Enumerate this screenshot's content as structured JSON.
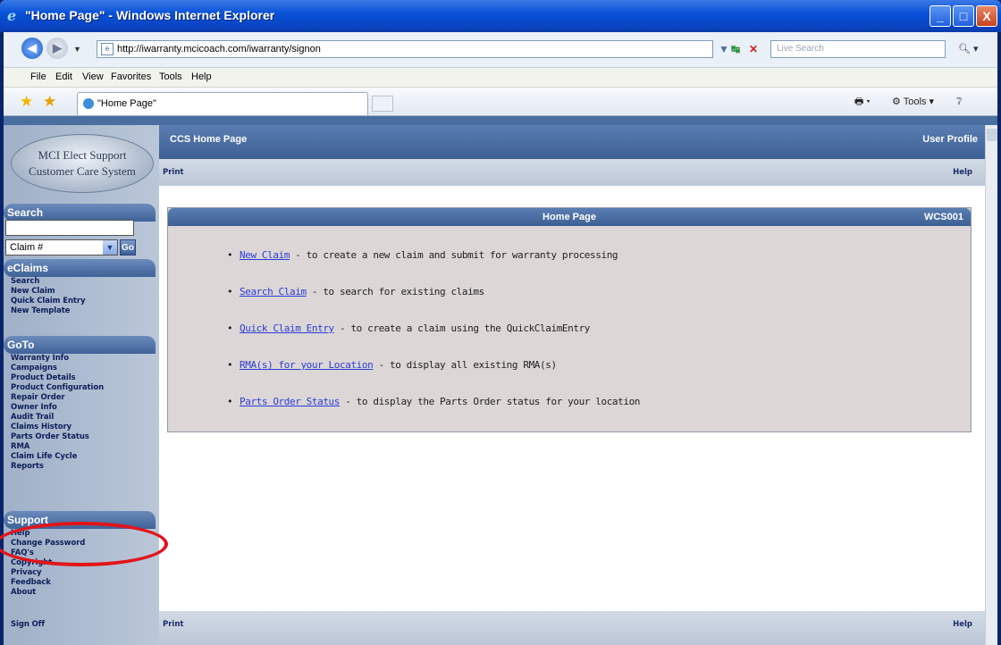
{
  "window": {
    "title": "\"Home Page\" - Windows Internet Explorer",
    "controls": [
      "_",
      "□",
      "X"
    ]
  },
  "address_bar": {
    "url": "http://iwarranty.mcicoach.com/iwarranty/signon",
    "search_placeholder": "Live Search"
  },
  "menu": [
    "File",
    "Edit",
    "View",
    "Favorites",
    "Tools",
    "Help"
  ],
  "tab": {
    "label": "\"Home Page\""
  },
  "command_bar": {
    "tools_label": "Tools"
  },
  "sidebar": {
    "logo_line1": "MCI Elect Support",
    "logo_line2": "Customer Care System",
    "search_title": "Search",
    "search_select_value": "Claim #",
    "go_label": "Go",
    "eclaims_title": "eClaims",
    "eclaims_links": [
      "Search",
      "New Claim",
      "Quick Claim Entry",
      "New Template"
    ],
    "goto_title": "GoTo",
    "goto_links": [
      "Warranty Info",
      "Campaigns",
      "Product Details",
      "Product Configuration",
      "Repair Order",
      "Owner Info",
      "Audit Trail",
      "Claims History",
      "Parts Order Status",
      "RMA",
      "Claim Life Cycle",
      "Reports"
    ],
    "support_title": "Support",
    "support_links": [
      "Help",
      "Change Password",
      "FAQ's",
      "Copyright",
      "Privacy",
      "Feedback",
      "About"
    ],
    "sign_off": "Sign Off"
  },
  "header": {
    "title": "CCS Home Page",
    "user_profile": "User Profile",
    "print": "Print",
    "help": "Help"
  },
  "panel": {
    "title": "Home Page",
    "code": "WCS001",
    "items": [
      {
        "link": "New Claim",
        "text": " - to create a new claim and submit for warranty processing"
      },
      {
        "link": "Search Claim",
        "text": " - to search for existing claims"
      },
      {
        "link": "Quick Claim Entry",
        "text": " - to create a claim using the QuickClaimEntry"
      },
      {
        "link": "RMA(s) for your Location",
        "text": " - to display all existing RMA(s)"
      },
      {
        "link": "Parts Order Status",
        "text": " - to display the Parts Order status for your location"
      }
    ]
  },
  "footer": {
    "print": "Print",
    "help": "Help"
  }
}
